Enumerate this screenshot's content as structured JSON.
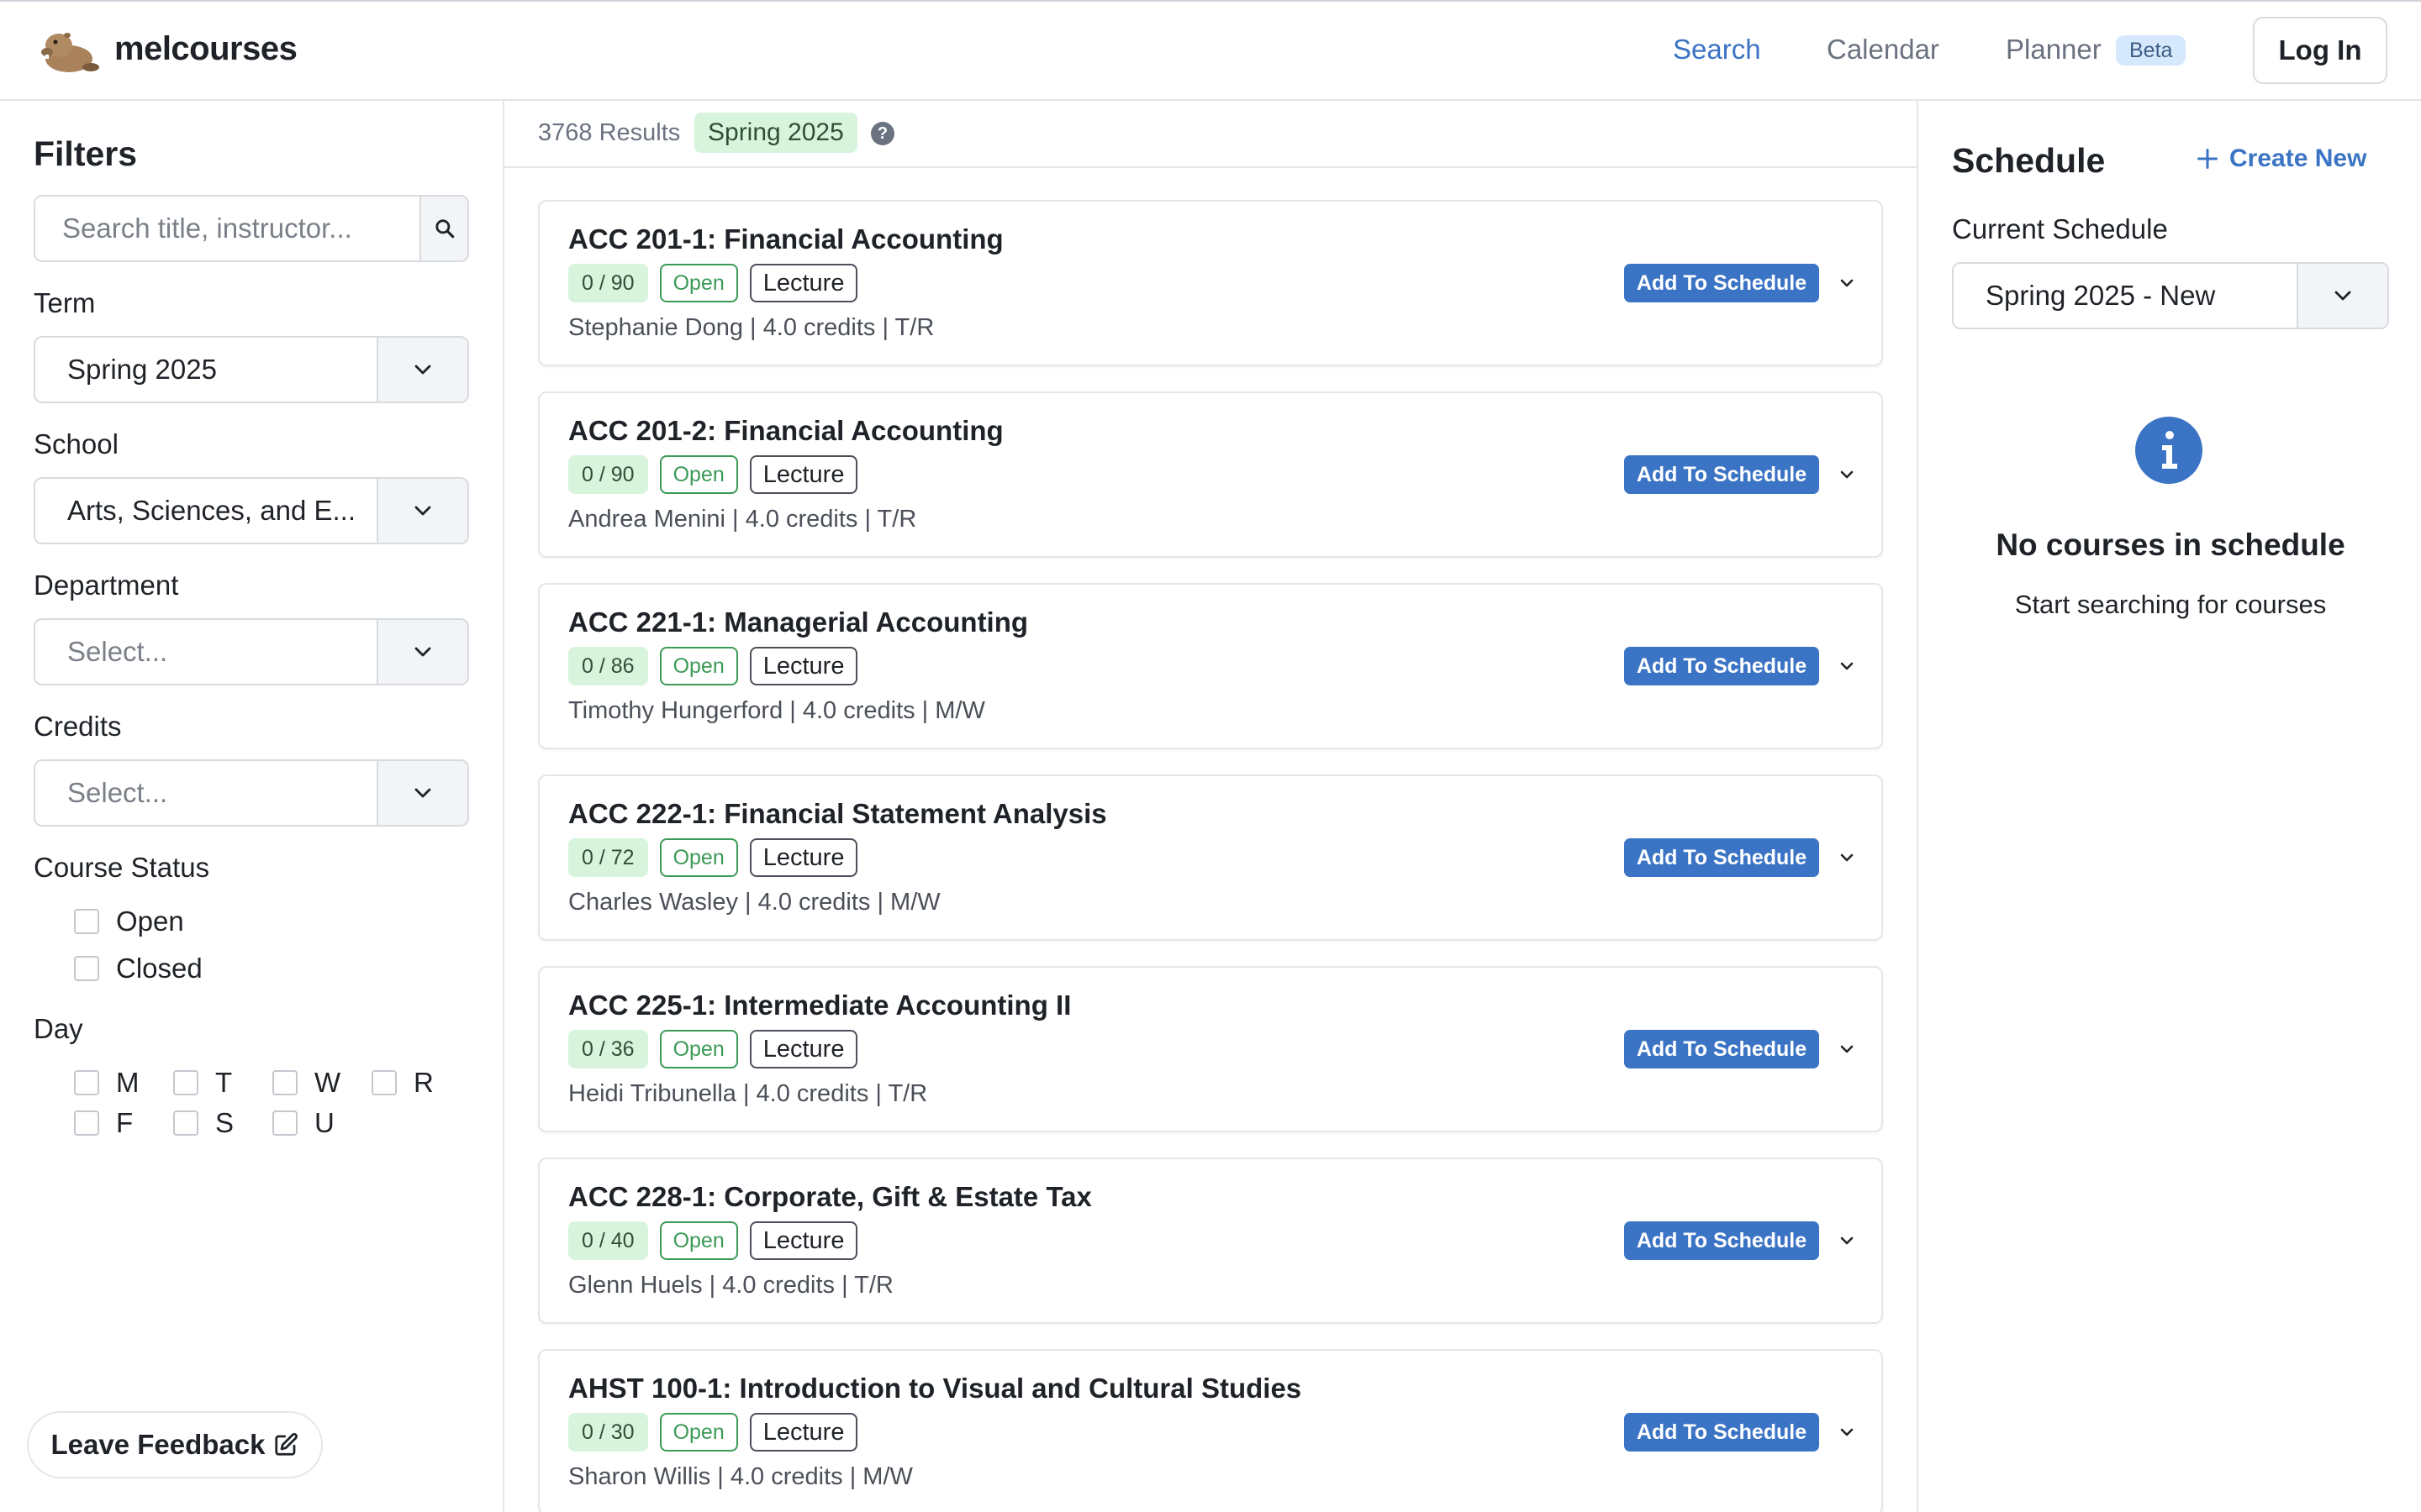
{
  "app": {
    "brand": "melcourses",
    "logo_icon": "beaver-logo-icon"
  },
  "nav": {
    "items": [
      {
        "label": "Search",
        "active": true
      },
      {
        "label": "Calendar",
        "active": false
      },
      {
        "label": "Planner",
        "active": false
      }
    ],
    "planner_badge": "Beta",
    "login_label": "Log In"
  },
  "filters": {
    "title": "Filters",
    "search_placeholder": "Search title, instructor...",
    "search_value": "",
    "term": {
      "label": "Term",
      "value": "Spring 2025"
    },
    "school": {
      "label": "School",
      "value": "Arts, Sciences, and E..."
    },
    "department": {
      "label": "Department",
      "placeholder": "Select..."
    },
    "credits": {
      "label": "Credits",
      "placeholder": "Select..."
    },
    "course_status": {
      "label": "Course Status",
      "options": [
        {
          "label": "Open",
          "checked": false
        },
        {
          "label": "Closed",
          "checked": false
        }
      ]
    },
    "day": {
      "label": "Day",
      "options": [
        {
          "label": "M",
          "checked": false
        },
        {
          "label": "T",
          "checked": false
        },
        {
          "label": "W",
          "checked": false
        },
        {
          "label": "R",
          "checked": false
        },
        {
          "label": "F",
          "checked": false
        },
        {
          "label": "S",
          "checked": false
        },
        {
          "label": "U",
          "checked": false
        }
      ]
    },
    "feedback_label": "Leave Feedback"
  },
  "results": {
    "count_text": "3768 Results",
    "term_badge": "Spring 2025",
    "help_glyph": "?"
  },
  "courses": [
    {
      "title": "ACC 201-1: Financial Accounting",
      "seats": "0 / 90",
      "status": "Open",
      "format": "Lecture",
      "meta": "Stephanie Dong | 4.0 credits | T/R",
      "add_label": "Add To Schedule"
    },
    {
      "title": "ACC 201-2: Financial Accounting",
      "seats": "0 / 90",
      "status": "Open",
      "format": "Lecture",
      "meta": "Andrea Menini | 4.0 credits | T/R",
      "add_label": "Add To Schedule"
    },
    {
      "title": "ACC 221-1: Managerial Accounting",
      "seats": "0 / 86",
      "status": "Open",
      "format": "Lecture",
      "meta": "Timothy Hungerford | 4.0 credits | M/W",
      "add_label": "Add To Schedule"
    },
    {
      "title": "ACC 222-1: Financial Statement Analysis",
      "seats": "0 / 72",
      "status": "Open",
      "format": "Lecture",
      "meta": "Charles Wasley | 4.0 credits | M/W",
      "add_label": "Add To Schedule"
    },
    {
      "title": "ACC 225-1: Intermediate Accounting II",
      "seats": "0 / 36",
      "status": "Open",
      "format": "Lecture",
      "meta": "Heidi Tribunella | 4.0 credits | T/R",
      "add_label": "Add To Schedule"
    },
    {
      "title": "ACC 228-1: Corporate, Gift & Estate Tax",
      "seats": "0 / 40",
      "status": "Open",
      "format": "Lecture",
      "meta": "Glenn Huels | 4.0 credits | T/R",
      "add_label": "Add To Schedule"
    },
    {
      "title": "AHST 100-1: Introduction to Visual and Cultural Studies",
      "seats": "0 / 30",
      "status": "Open",
      "format": "Lecture",
      "meta": "Sharon Willis | 4.0 credits | M/W",
      "add_label": "Add To Schedule"
    }
  ],
  "schedule": {
    "title": "Schedule",
    "create_label": "Create New",
    "current_label": "Current Schedule",
    "current_value": "Spring 2025 - New",
    "empty_title": "No courses in schedule",
    "empty_subtitle": "Start searching for courses"
  },
  "colors": {
    "accent": "#3b74c4",
    "open_green": "#3c9a57",
    "seats_bg": "#d8f4dd",
    "beta_bg": "#d6e8fb"
  }
}
